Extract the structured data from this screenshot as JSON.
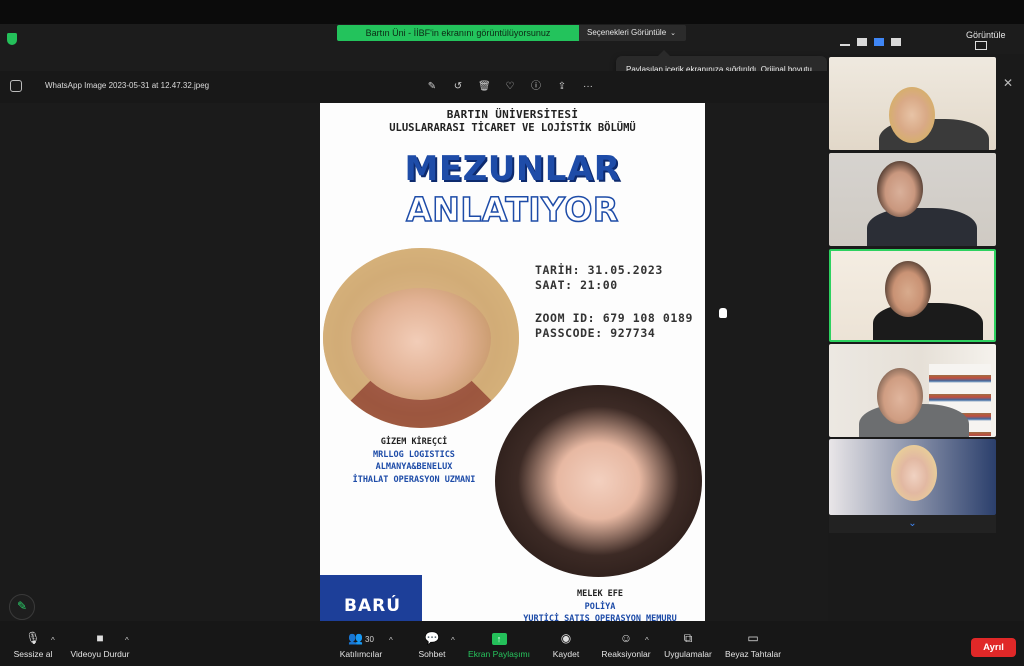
{
  "meeting": {
    "share_notice": "Bartın Üni - İİBF'in ekranını görüntülüyorsunuz",
    "view_options": "Seçenekleri Görüntüle",
    "view_label": "Görüntüle",
    "tooltip": "Paylaşılan içerik ekranınıza sığdırıldı. Orijinal boyutu görmek için menüden \"Orijinal boyut\" üzerine tıklayın."
  },
  "viewer": {
    "filename": "WhatsApp Image 2023-05-31 at 12.47.32.jpeg",
    "tools": [
      "edit-icon",
      "rotate-icon",
      "trash-icon",
      "heart-icon",
      "info-icon",
      "share-icon",
      "more-icon"
    ]
  },
  "poster": {
    "university": "BARTIN ÜNİVERSİTESİ",
    "department": "ULUSLARARASI TİCARET VE LOJİSTİK BÖLÜMÜ",
    "title_line1": "MEZUNLAR",
    "title_line2": "ANLATIYOR",
    "date": "TARİH: 31.05.2023",
    "time": "SAAT: 21:00",
    "zoom_id": "ZOOM ID: 679 108 0189",
    "passcode": "PASSCODE: 927734",
    "speaker1": {
      "name": "GİZEM KİREÇCİ",
      "line1": "MRLLOG LOGISTICS",
      "line2": "ALMANYA&BENELUX",
      "line3": "İTHALAT OPERASYON UZMANI"
    },
    "speaker2": {
      "name": "MELEK EFE",
      "line1": "POLİYA",
      "line2": "YURTİÇİ SATIŞ OPERASYON MEMURU"
    },
    "logo": "BARÚ"
  },
  "toolbar": {
    "mute": "Sessize al",
    "video": "Videoyu Durdur",
    "participants": "Katılımcılar",
    "participant_count": "30",
    "chat": "Sohbet",
    "share": "Ekran Paylaşımı",
    "record": "Kaydet",
    "reactions": "Reaksiyonlar",
    "apps": "Uygulamalar",
    "whiteboard": "Beyaz Tahtalar",
    "leave": "Ayrıl"
  },
  "colors": {
    "share_green": "#23c35c",
    "leave_red": "#e02828",
    "poster_blue": "#1e4ca8",
    "active_speaker_border": "#2ed160"
  }
}
